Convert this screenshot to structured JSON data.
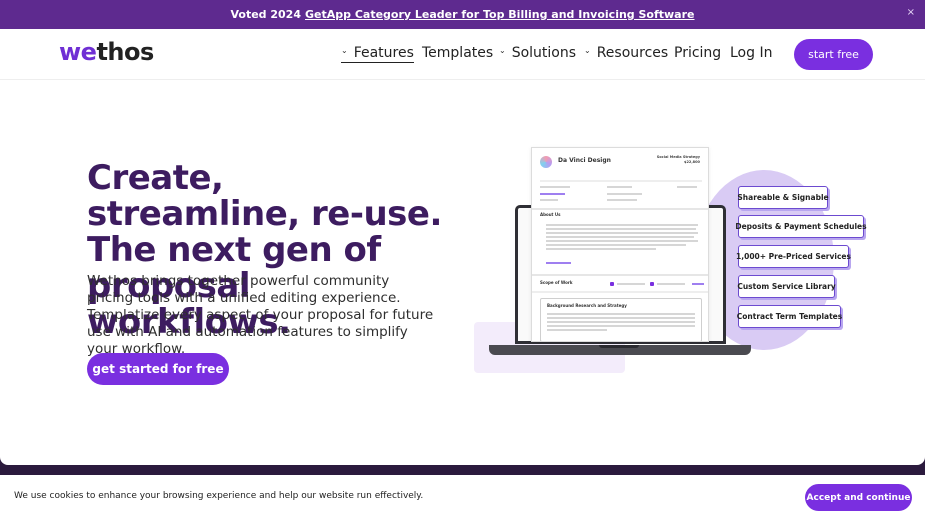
{
  "banner": {
    "text": "Voted 2024",
    "link": "GetApp Category Leader for Top Billing and Invoicing Software",
    "close_icon": "×"
  },
  "nav": {
    "logo_prefix": "we",
    "logo_suffix": "thos",
    "items": [
      {
        "label": "Features",
        "dropdown": true
      },
      {
        "label": "Templates",
        "dropdown": false
      },
      {
        "label": "Solutions",
        "dropdown": true
      },
      {
        "label": "Resources",
        "dropdown": true
      },
      {
        "label": "Pricing",
        "dropdown": false
      },
      {
        "label": "Log In",
        "dropdown": false
      }
    ],
    "chevron": "⌄",
    "start_label": "start free"
  },
  "hero": {
    "headline": "Create, streamline, re-use. The next gen of proposal workflows.",
    "description": "Wethos brings together powerful community pricing tools with a unified editing experience. Templatize every aspect of your proposal for future use with AI and automation features to simplify your workflow.",
    "cta_label": "get started for free"
  },
  "illustration": {
    "doc_title": "Da Vinci Design",
    "doc_sub_1": "Social Media Strategy",
    "doc_sub_2": "$22,800",
    "section_about": "About Us",
    "section_scope": "Scope of Work",
    "section_box": "Background Research and Strategy",
    "tags": [
      "Shareable & Signable",
      "Deposits & Payment Schedules",
      "1,000+ Pre-Priced Services",
      "Custom Service Library",
      "Contract Term Templates"
    ]
  },
  "cookie": {
    "text": "We use cookies to enhance your browsing experience and help our website run effectively.",
    "accept_label": "Accept and continue"
  },
  "colors": {
    "brand_purple": "#7a2fe0",
    "banner_purple": "#5e2a8f",
    "headline": "#3d1c60"
  }
}
